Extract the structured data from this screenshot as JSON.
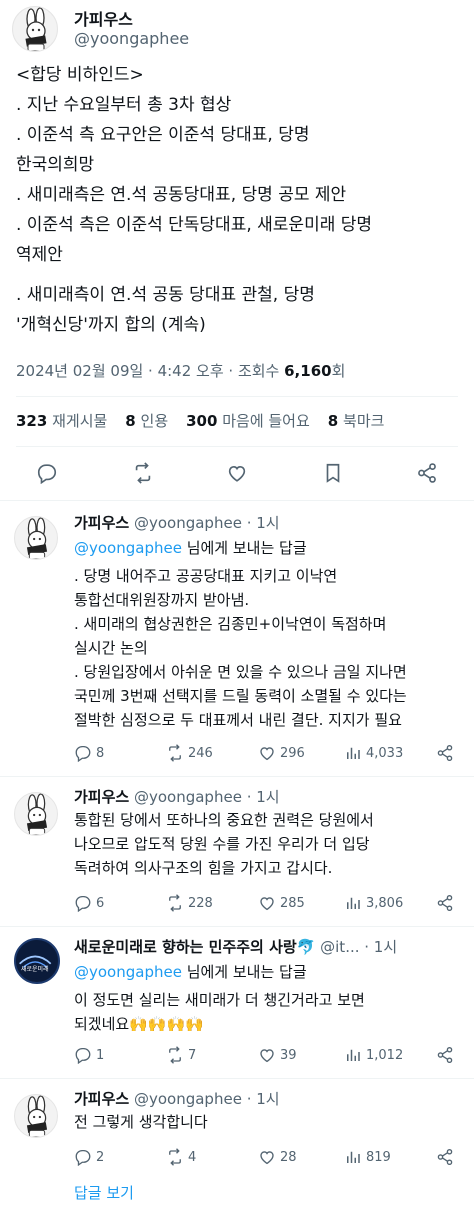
{
  "main_tweet": {
    "display_name": "가피우스",
    "handle": "@yoongaphee",
    "lines": [
      "<합당 비하인드>",
      ". 지난 수요일부터 총 3차 협상",
      ". 이준석 측 요구안은 이준석 당대표, 당명",
      "한국의희망",
      ". 새미래측은 연.석 공동당대표, 당명 공모 제안",
      ". 이준석 측은 이준석 단독당대표, 새로운미래 당명",
      "역제안",
      ". 새미래측이 연.석 공동 당대표 관철, 당명",
      "'개혁신당'까지 합의 (계속)"
    ],
    "date": "2024년 02월 09일 · 4:42 오후 · 조회수 ",
    "views": "6,160",
    "views_suffix": "회",
    "stats": {
      "retweets": "323",
      "retweets_label": "재게시물",
      "quotes": "8",
      "quotes_label": "인용",
      "likes": "300",
      "likes_label": "마음에 들어요",
      "bookmarks": "8",
      "bookmarks_label": "북마크"
    }
  },
  "replies": [
    {
      "display_name": "가피우스",
      "handle_time": "@yoongaphee · 1시",
      "replying_to": "@yoongaphee",
      "replying_suffix": " 님에게 보내는 답글",
      "lines": [
        ". 당명 내어주고 공공당대표 지키고 이낙연",
        "통합선대위원장까지 받아냄.",
        ". 새미래의 협상권한은 김종민+이낙연이 독점하며",
        "실시간 논의",
        ". 당원입장에서 아쉬운 면 있을 수 있으나 금일 지나면",
        "국민께 3번째 선택지를 드릴 동력이 소멸될 수 있다는",
        "절박한 심정으로 두 대표께서 내린 결단. 지지가 필요"
      ],
      "actions": {
        "replies": "8",
        "retweets": "246",
        "likes": "296",
        "views": "4,033"
      }
    },
    {
      "display_name": "가피우스",
      "handle_time": "@yoongaphee · 1시",
      "lines": [
        "통합된 당에서 또하나의 중요한 권력은 당원에서",
        "나오므로 압도적 당원 수를 가진 우리가 더 입당",
        "독려하여 의사구조의 힘을 가지고 갑시다."
      ],
      "actions": {
        "replies": "6",
        "retweets": "228",
        "likes": "285",
        "views": "3,806"
      }
    },
    {
      "display_name": "새로운미래로 향하는 민주주의 사랑🐬",
      "handle_time": "@it... · 1시",
      "replying_to": "@yoongaphee",
      "replying_suffix": " 님에게 보내는 답글",
      "lines": [
        "이 정도면 실리는 새미래가 더 챙긴거라고 보면",
        "되겠네요🙌🙌🙌🙌"
      ],
      "actions": {
        "replies": "1",
        "retweets": "7",
        "likes": "39",
        "views": "1,012"
      }
    },
    {
      "display_name": "가피우스",
      "handle_time": "@yoongaphee · 1시",
      "lines": [
        "전 그렇게 생각합니다"
      ],
      "actions": {
        "replies": "2",
        "retweets": "4",
        "likes": "28",
        "views": "819"
      }
    }
  ],
  "show_replies": "답글 보기",
  "avatar_logo_text": "새로운미래",
  "colors": {
    "accent": "#1d9bf0",
    "text": "#0f1419",
    "muted": "#536471",
    "divider": "#eff3f4"
  }
}
